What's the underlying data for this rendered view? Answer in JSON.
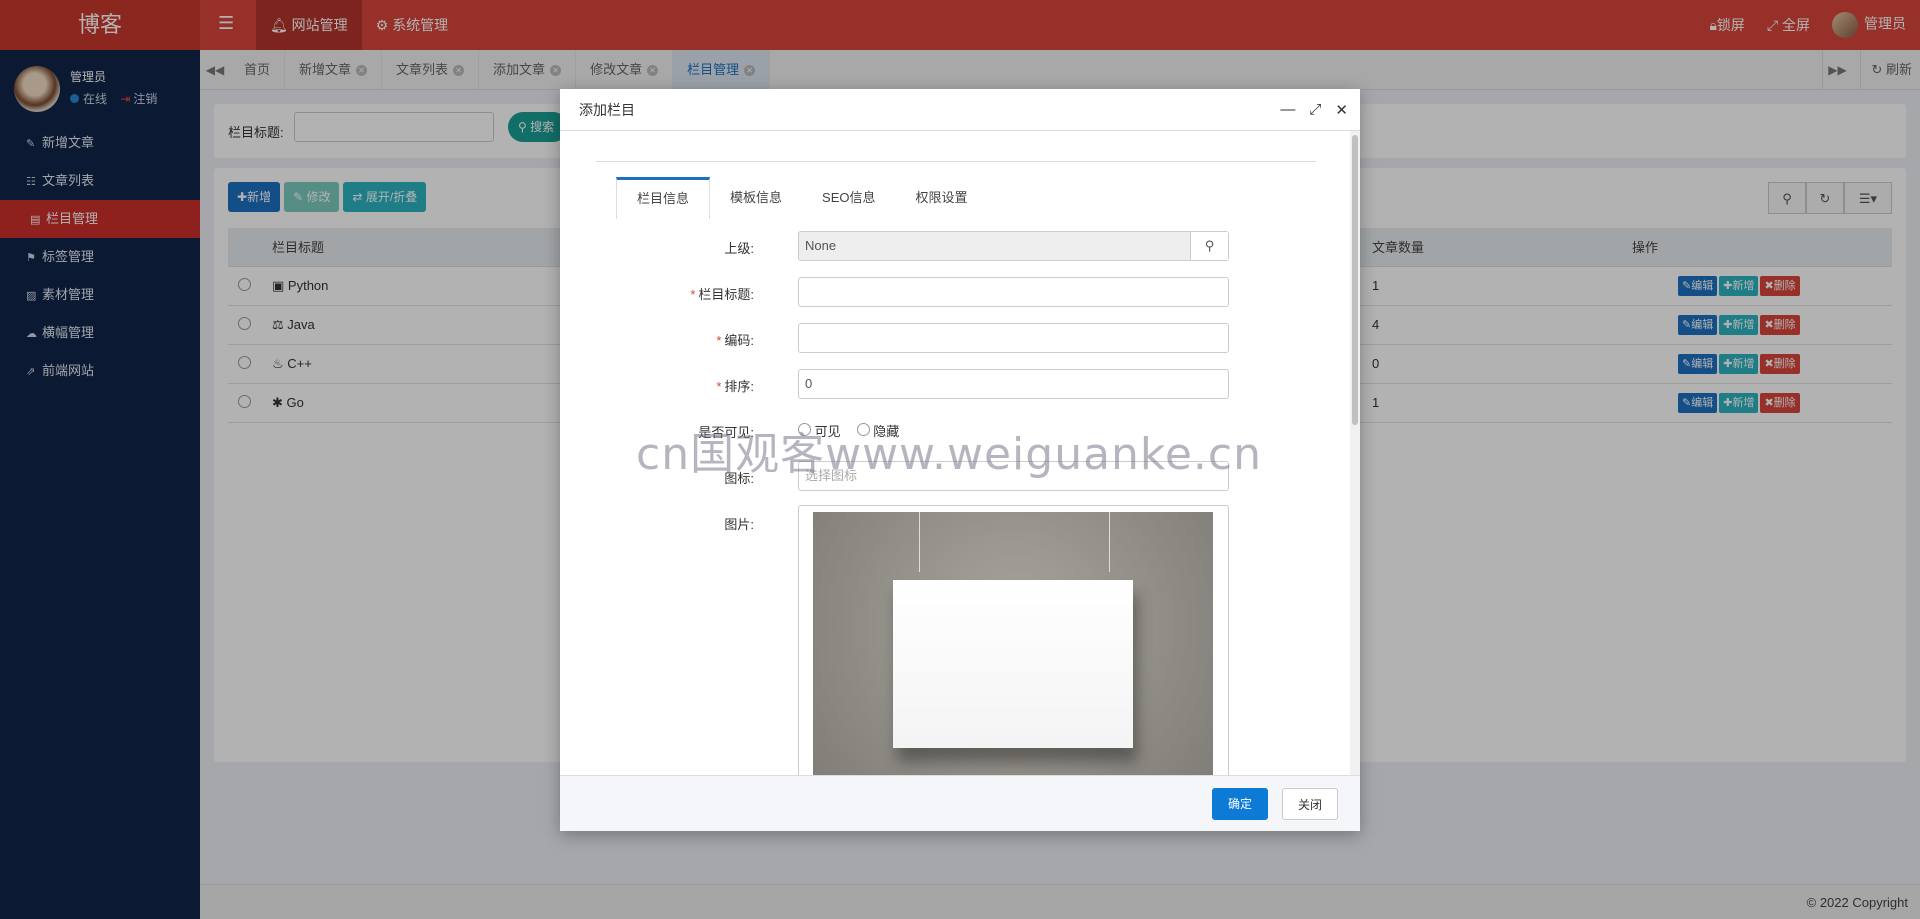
{
  "app": {
    "logo": "博客"
  },
  "topnav": {
    "items": [
      {
        "label": "网站管理",
        "icon": "bell-icon"
      },
      {
        "label": "系统管理",
        "icon": "gear-icon"
      }
    ]
  },
  "topright": {
    "lock": "锁屏",
    "fullscreen": "全屏",
    "user": "管理员"
  },
  "sidebar": {
    "user": {
      "name": "管理员",
      "status": "在线",
      "logout": "注销"
    },
    "items": [
      {
        "label": "新增文章",
        "icon": "✎"
      },
      {
        "label": "文章列表",
        "icon": "☷"
      },
      {
        "label": "栏目管理",
        "icon": "▤"
      },
      {
        "label": "标签管理",
        "icon": "⚑"
      },
      {
        "label": "素材管理",
        "icon": "▨"
      },
      {
        "label": "横幅管理",
        "icon": "☁"
      },
      {
        "label": "前端网站",
        "icon": "⇗"
      }
    ]
  },
  "tabs": {
    "items": [
      {
        "label": "首页"
      },
      {
        "label": "新增文章"
      },
      {
        "label": "文章列表"
      },
      {
        "label": "添加文章"
      },
      {
        "label": "修改文章"
      },
      {
        "label": "栏目管理"
      }
    ],
    "refresh": "刷新"
  },
  "search": {
    "label": "栏目标题:",
    "button": "搜索"
  },
  "toolbar": {
    "add": "新增",
    "edit": "修改",
    "expand": "展开/折叠"
  },
  "table": {
    "headers": {
      "title": "栏目标题",
      "count": "文章数量",
      "ops": "操作"
    },
    "rows": [
      {
        "title": "Python",
        "icon": "▣",
        "count": "1"
      },
      {
        "title": "Java",
        "icon": "⚖",
        "count": "4"
      },
      {
        "title": "C++",
        "icon": "♨",
        "count": "0"
      },
      {
        "title": "Go",
        "icon": "✱",
        "count": "1"
      }
    ],
    "actions": {
      "edit": "编辑",
      "add": "新增",
      "delete": "删除"
    }
  },
  "footer": {
    "copyright": "© 2022 Copyright"
  },
  "modal": {
    "title": "添加栏目",
    "tabs": [
      "栏目信息",
      "模板信息",
      "SEO信息",
      "权限设置"
    ],
    "fields": {
      "parent": {
        "label": "上级:",
        "value": "None"
      },
      "title": {
        "label": "栏目标题:"
      },
      "code": {
        "label": "编码:"
      },
      "order": {
        "label": "排序:",
        "value": "0"
      },
      "visible": {
        "label": "是否可见:",
        "opt_show": "可见",
        "opt_hide": "隐藏"
      },
      "icon": {
        "label": "图标:",
        "placeholder": "选择图标"
      },
      "image": {
        "label": "图片:"
      }
    },
    "ok": "确定",
    "close": "关闭"
  },
  "watermark": "cn国观客www.weiguanke.cn"
}
